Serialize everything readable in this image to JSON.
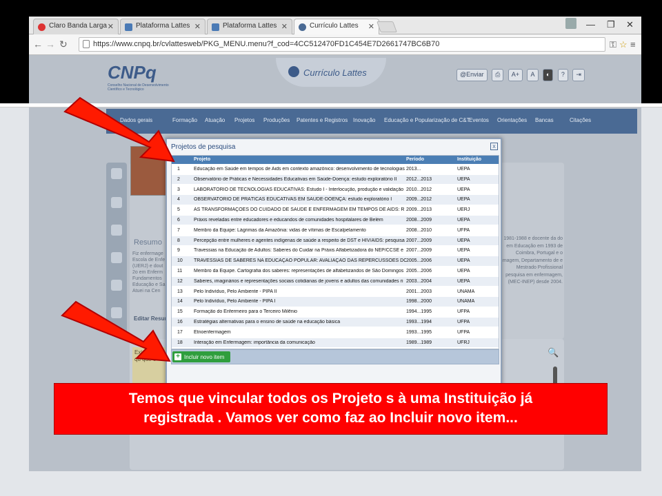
{
  "browser": {
    "tabs": [
      {
        "label": "Claro Banda Larga",
        "color": "#d33"
      },
      {
        "label": "Plataforma Lattes",
        "color": "#4a7ab5"
      },
      {
        "label": "Plataforma Lattes",
        "color": "#4a7ab5"
      },
      {
        "label": "Currículo Lattes",
        "color": "#4a6a94"
      }
    ],
    "url": "https://www.cnpq.br/cvlattesweb/PKG_MENU.menu?f_cod=4CC512470FD1C454E7D2661747BC6B70"
  },
  "site": {
    "logo": "CNPq",
    "logo_sub": "Conselho Nacional de Desenvolvimento Científico e Tecnológico",
    "badge": "Currículo Lattes",
    "tool_enviar": "Enviar",
    "menu": [
      "Dados gerais",
      "Formação",
      "Atuação",
      "Projetos",
      "Produções",
      "Patentes e Registros",
      "Inovação",
      "Educação e Popularização de C&T",
      "Eventos",
      "Orientações",
      "Bancas",
      "Citações"
    ],
    "resumo_title": "Resumo",
    "left_text": "Fiz enfermage Escola de Enfe (UERJ) e dout 2o em Enferm Fundamentos Educação e Sa Atuei na Cen",
    "right_text": "1981-1988 e docente da do em Educação em 1993 de Coimbra, Portugal e o magem, Departamento de e Mestrado Profissional pesquisa em enfermagem, (MEC-INEP) desde 2004.",
    "editar": "Editar Resumo",
    "yellow_text": "Existe Para qu que o"
  },
  "modal": {
    "title": "Projetos de pesquisa",
    "headers": {
      "projeto": "Projeto",
      "periodo": "Período",
      "instituicao": "Instituição"
    },
    "rows": [
      {
        "n": "1",
        "projeto": "Educação em Saúde em tempos de Aids em contexto amazônico: desenvolvimento de tecnologias",
        "periodo": "2013...",
        "inst": "UEPA"
      },
      {
        "n": "2",
        "projeto": "Observatório de Práticas e Necessidades Educativas em Saúde-Doença: estudo exploratório II",
        "periodo": "2012...2013",
        "inst": "UEPA"
      },
      {
        "n": "3",
        "projeto": "LABORATÓRIO DE TECNOLOGIAS EDUCATIVAS: Estudo I - Interlocução, produção e validação",
        "periodo": "2010...2012",
        "inst": "UEPA"
      },
      {
        "n": "4",
        "projeto": "OBSERVATÓRIO DE PRÁTICAS EDUCATIVAS EM SAÚDE-DOENÇA: estudo exploratório I",
        "periodo": "2009...2012",
        "inst": "UEPA"
      },
      {
        "n": "5",
        "projeto": "AS TRANSFORMAÇÕES DO CUIDADO DE SAÚDE E ENFERMAGEM EM TEMPOS DE AIDS: R",
        "periodo": "2009...2013",
        "inst": "UERJ"
      },
      {
        "n": "6",
        "projeto": "Práxis reveladas entre educadores e educandos de comunidades hospitalares de Belém",
        "periodo": "2008...2009",
        "inst": "UEPA"
      },
      {
        "n": "7",
        "projeto": "Membro da Equipe: Lágrimas da Amazônia: vidas de vítimas de Escalpelamento",
        "periodo": "2008...2010",
        "inst": "UFPA"
      },
      {
        "n": "8",
        "projeto": "Percepção entre mulheres e agentes indígenas de saúde a respeito de DST e HIV/AIDS: pesquisa",
        "periodo": "2007...2009",
        "inst": "UEPA"
      },
      {
        "n": "9",
        "projeto": "Travessias na Educação de Adultos: Saberes do Cuidar na Práxis Alfabetizadora do NEP/CCSE e",
        "periodo": "2007...2009",
        "inst": "UEPA"
      },
      {
        "n": "10",
        "projeto": "TRAVESSIAS DE SABERES NA EDUCAÇÃO POPULAR: AVALIAÇÃO DAS REPERCUSSÕES DO",
        "periodo": "2005...2006",
        "inst": "UEPA"
      },
      {
        "n": "11",
        "projeto": "Membro da Equipe. Cartografia dos saberes: representações de alfabetizandos de São Domingos",
        "periodo": "2005...2006",
        "inst": "UEPA"
      },
      {
        "n": "12",
        "projeto": "Saberes, imaginários e representações sociais cotidianas de jovens e adultos das comunidades ri",
        "periodo": "2003...2004",
        "inst": "UEPA"
      },
      {
        "n": "13",
        "projeto": "Pelo Indivíduo, Pelo Ambiente - PIPA II",
        "periodo": "2001...2003",
        "inst": "UNAMA"
      },
      {
        "n": "14",
        "projeto": "Pelo Indivíduo, Pelo Ambiente - PIPA I",
        "periodo": "1998...2000",
        "inst": "UNAMA"
      },
      {
        "n": "15",
        "projeto": "Formação do Enfermeiro para o Terceiro Milênio",
        "periodo": "1994...1995",
        "inst": "UFPA"
      },
      {
        "n": "16",
        "projeto": "Estratégias alternativas para o ensino de saúde na educação básica",
        "periodo": "1993...1994",
        "inst": "UFPA"
      },
      {
        "n": "17",
        "projeto": "Etnoenfermagem",
        "periodo": "1993...1995",
        "inst": "UFPA"
      },
      {
        "n": "18",
        "projeto": "Interação em Enfermagem: importância da comunicação",
        "periodo": "1989...1989",
        "inst": "UFRJ"
      }
    ],
    "add_label": "Incluir novo item"
  },
  "caption": {
    "line1": "Temos que vincular todos os Projeto s à uma Instituição já",
    "line2": "registrada . Vamos ver como faz ao Incluir novo item..."
  },
  "colors": {
    "arrow": "#ff1a00",
    "caption_bg": "#ff0000",
    "header": "#4b7eb4",
    "add_button": "#2f9e3d"
  }
}
